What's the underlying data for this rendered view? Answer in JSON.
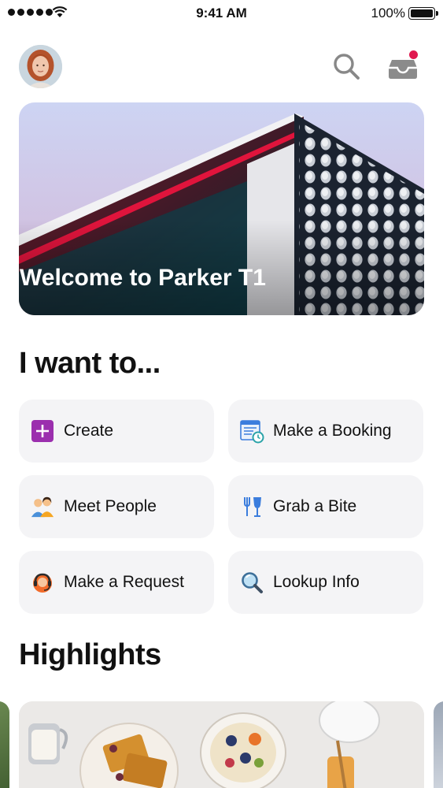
{
  "status_bar": {
    "time": "9:41 AM",
    "battery": "100%",
    "signal_icon": "signal-dots-icon",
    "wifi_icon": "wifi-icon",
    "battery_icon": "battery-icon"
  },
  "header": {
    "avatar_icon": "user-avatar",
    "search_icon": "search-icon",
    "inbox_icon": "inbox-icon",
    "has_notification": true
  },
  "hero": {
    "title": "Welcome to Parker T1"
  },
  "want_to": {
    "title": "I want to...",
    "actions": [
      {
        "label": "Create",
        "icon": "plus-square-icon",
        "color": "#9b2fae"
      },
      {
        "label": "Make a Booking",
        "icon": "calendar-clock-icon",
        "color": "#3b7ddd"
      },
      {
        "label": "Meet People",
        "icon": "people-icon",
        "color": "#f5a623"
      },
      {
        "label": "Grab a Bite",
        "icon": "fork-glass-icon",
        "color": "#3b7ddd"
      },
      {
        "label": "Make a Request",
        "icon": "headset-icon",
        "color": "#f26b2a"
      },
      {
        "label": "Lookup Info",
        "icon": "magnifier-icon",
        "color": "#4aa3df"
      }
    ]
  },
  "highlights": {
    "title": "Highlights"
  },
  "colors": {
    "card_background": "#f4f4f6",
    "notification": "#e0194f"
  }
}
